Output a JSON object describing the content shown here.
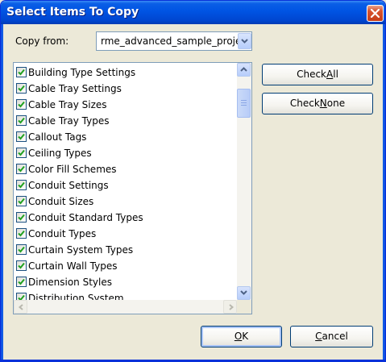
{
  "window": {
    "title": "Select Items To Copy"
  },
  "copy_from": {
    "label": "Copy from:",
    "value": "rme_advanced_sample_proje"
  },
  "list": {
    "items": [
      {
        "label": "Building Type Settings",
        "checked": true
      },
      {
        "label": "Cable Tray Settings",
        "checked": true
      },
      {
        "label": "Cable Tray Sizes",
        "checked": true
      },
      {
        "label": "Cable Tray Types",
        "checked": true
      },
      {
        "label": "Callout Tags",
        "checked": true
      },
      {
        "label": "Ceiling Types",
        "checked": true
      },
      {
        "label": "Color Fill Schemes",
        "checked": true
      },
      {
        "label": "Conduit Settings",
        "checked": true
      },
      {
        "label": "Conduit Sizes",
        "checked": true
      },
      {
        "label": "Conduit Standard Types",
        "checked": true
      },
      {
        "label": "Conduit Types",
        "checked": true
      },
      {
        "label": "Curtain System Types",
        "checked": true
      },
      {
        "label": "Curtain Wall Types",
        "checked": true
      },
      {
        "label": "Dimension Styles",
        "checked": true
      },
      {
        "label": "Distribution System",
        "checked": true
      }
    ]
  },
  "buttons": {
    "check_all": {
      "pre": "Check ",
      "key": "A",
      "post": "ll"
    },
    "check_none": {
      "pre": "Check ",
      "key": "N",
      "post": "one"
    },
    "ok": {
      "pre": "",
      "key": "O",
      "post": "K"
    },
    "cancel": {
      "pre": "",
      "key": "C",
      "post": "ancel"
    }
  },
  "colors": {
    "title_bar": "#0054e3",
    "dialog_bg": "#ece9d8",
    "check_mark": "#21a121"
  },
  "icons": {
    "close": "close-icon",
    "dropdown": "chevron-down-icon",
    "scroll_up": "arrow-up-icon",
    "scroll_down": "arrow-down-icon",
    "scroll_left": "arrow-left-icon",
    "scroll_right": "arrow-right-icon",
    "check": "checkmark-icon"
  }
}
